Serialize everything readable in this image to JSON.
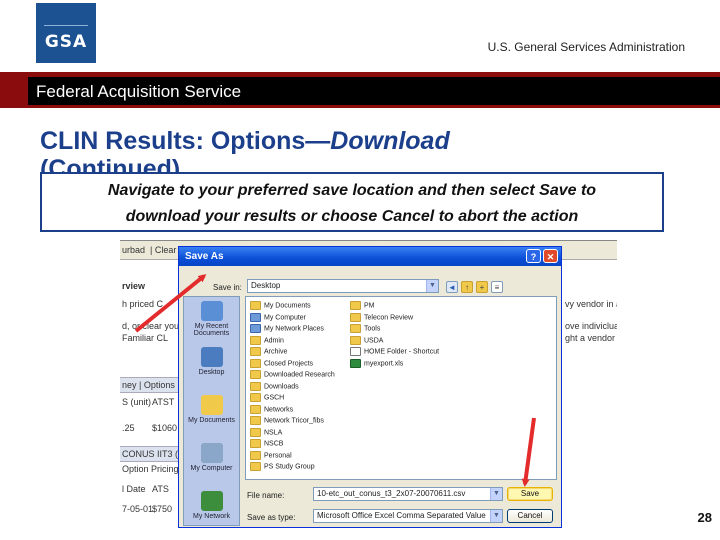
{
  "header": {
    "logo_text": "GSA",
    "agency": "U.S. General Services Administration",
    "service": "Federal Acquisition Service"
  },
  "slide": {
    "title_plain": "CLIN Results: Options—",
    "title_italic": "Download",
    "title_cont": "(Continued)",
    "instruction_line1": "Navigate to your preferred save location and then select Save to",
    "instruction_line2": "download your results or choose Cancel to abort the action",
    "page_number": "28"
  },
  "background_app": {
    "toolbar": [
      "urbad",
      "| Clear"
    ],
    "overview": "rview",
    "left_texts": [
      "h priced C",
      "d, or clear your",
      "Familiar CL"
    ],
    "right_texts": [
      "vy vendor in a",
      "ove indiviclua",
      "ght a vendor"
    ],
    "tabs": "ney | Options",
    "cells": [
      "S (unit)",
      "ATST",
      ".25",
      "$1060",
      "CONUS IIT3 (Pa",
      "Option Pricing",
      "l Date",
      "ATS",
      "7-05-01",
      "$750"
    ]
  },
  "dialog": {
    "title": "Save As",
    "save_in_label": "Save in:",
    "save_in_value": "Desktop",
    "places": [
      {
        "label": "My Recent\nDocuments",
        "icon": "recent-icon",
        "color": "#5a8fd6"
      },
      {
        "label": "Desktop",
        "icon": "desktop-icon",
        "color": "#4b7cc0"
      },
      {
        "label": "My Documents",
        "icon": "my-documents-icon",
        "color": "#f0c84a"
      },
      {
        "label": "My Computer",
        "icon": "my-computer-icon",
        "color": "#8aa6c9"
      },
      {
        "label": "My Network",
        "icon": "my-network-icon",
        "color": "#3c8d3c"
      }
    ],
    "files_col1": [
      {
        "name": "My Documents",
        "type": "folder"
      },
      {
        "name": "My Computer",
        "type": "sys"
      },
      {
        "name": "My Network Places",
        "type": "sys"
      },
      {
        "name": "Admin",
        "type": "folder"
      },
      {
        "name": "Archive",
        "type": "folder"
      },
      {
        "name": "Closed Projects",
        "type": "folder"
      },
      {
        "name": "Downloaded Research",
        "type": "folder"
      },
      {
        "name": "Downloads",
        "type": "folder"
      },
      {
        "name": "GSCH",
        "type": "folder"
      },
      {
        "name": "Networks",
        "type": "folder"
      },
      {
        "name": "Network Tricor_fibs",
        "type": "folder"
      },
      {
        "name": "NSLA",
        "type": "folder"
      },
      {
        "name": "NSCB",
        "type": "folder"
      },
      {
        "name": "Personal",
        "type": "folder"
      },
      {
        "name": "PS Study Group",
        "type": "folder"
      }
    ],
    "files_col2": [
      {
        "name": "PM",
        "type": "folder"
      },
      {
        "name": "Telecon Review",
        "type": "folder"
      },
      {
        "name": "Tools",
        "type": "folder"
      },
      {
        "name": "USDA",
        "type": "folder"
      },
      {
        "name": "HOME Folder - Shortcut",
        "type": "file"
      },
      {
        "name": "myexport.xls",
        "type": "xl"
      }
    ],
    "filename_label": "File name:",
    "filename_value": "10-etc_out_conus_t3_2x07-20070611.csv",
    "filetype_label": "Save as type:",
    "filetype_value": "Microsoft Office Excel Comma Separated Value",
    "save_button": "Save",
    "cancel_button": "Cancel"
  },
  "colors": {
    "gsa_blue": "#1c5291",
    "band_red": "#8b0c0c",
    "title_blue": "#1c3f8c",
    "arrow_red": "#e32b2b"
  }
}
